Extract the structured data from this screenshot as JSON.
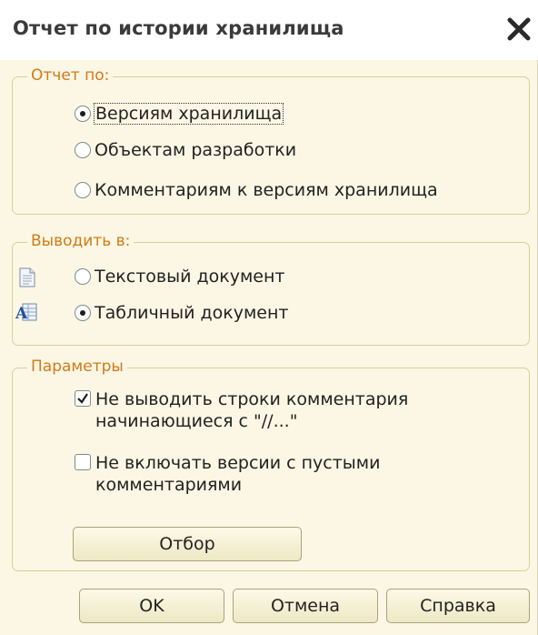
{
  "window": {
    "title": "Отчет по истории хранилища"
  },
  "report_by": {
    "legend": "Отчет по:",
    "options": [
      {
        "label": "Версиям хранилища",
        "selected": true
      },
      {
        "label": "Объектам разработки",
        "selected": false
      },
      {
        "label": "Комментариям к версиям хранилища",
        "selected": false
      }
    ]
  },
  "output_to": {
    "legend": "Выводить в:",
    "options": [
      {
        "label": "Текстовый документ",
        "selected": false,
        "icon": "text-document-icon"
      },
      {
        "label": "Табличный документ",
        "selected": true,
        "icon": "spreadsheet-document-icon"
      }
    ]
  },
  "params": {
    "legend": "Параметры",
    "skip_comment_lines": {
      "label": "Не выводить строки комментария\nначинающиеся с \"//...\"",
      "checked": true
    },
    "exclude_empty_comments": {
      "label": "Не включать версии с пустыми\nкомментариями",
      "checked": false
    },
    "filter_button": "Отбор"
  },
  "footer": {
    "ok": "OK",
    "cancel": "Отмена",
    "help": "Справка"
  },
  "colors": {
    "background": "#fbf7e4",
    "group_border": "#d9cf97",
    "legend_text": "#d27a18",
    "button_border": "#a9a27a"
  }
}
